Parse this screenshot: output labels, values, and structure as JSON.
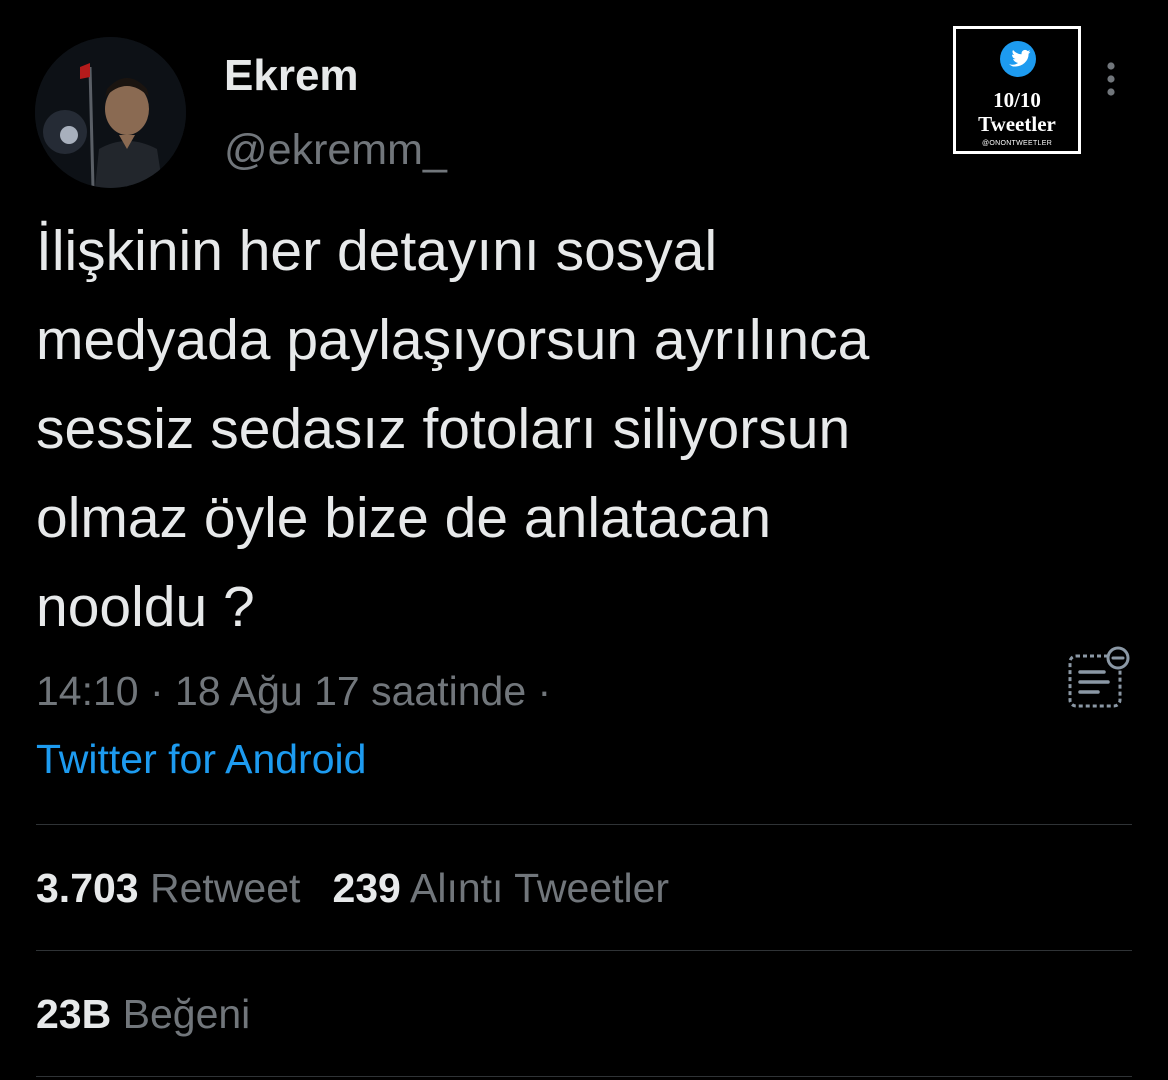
{
  "user": {
    "display_name": "Ekrem",
    "handle": "@ekremm_"
  },
  "badge": {
    "line1": "10/10",
    "line2": "Tweetler",
    "line3": "@ONONTWEETLER",
    "icon": "twitter-bird-icon"
  },
  "tweet": {
    "lines": [
      "İlişkinin her detayını sosyal",
      "medyada paylaşıyorsun ayrılınca",
      "sessiz sedasız fotoları siliyorsun",
      "olmaz öyle bize de anlatacan",
      "nooldu ?"
    ],
    "timestamp": "14:10 · 18 Ağu 17 saatinde ·",
    "source": "Twitter for Android"
  },
  "stats": {
    "retweets_count": "3.703",
    "retweets_label": "Retweet",
    "quotes_count": "239",
    "quotes_label": "Alıntı Tweetler",
    "likes_count": "23B",
    "likes_label": "Beğeni"
  },
  "colors": {
    "background": "#000000",
    "text": "#e7e9ea",
    "secondary": "#71767b",
    "accent": "#1d9bf0",
    "divider": "#2f3336"
  },
  "icons": [
    "avatar",
    "twitter-bird-icon",
    "more-options-icon",
    "tweet-analytics-icon"
  ]
}
